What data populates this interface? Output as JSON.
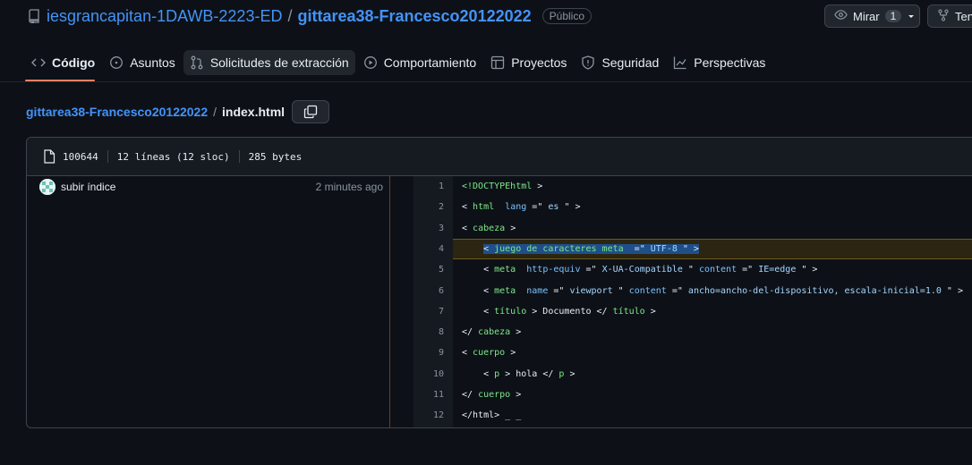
{
  "repo": {
    "owner": "iesgrancapitan-1DAWB-2223-ED",
    "separator": "/",
    "name": "gittarea38-Francesco20122022",
    "visibility": "Público"
  },
  "actions": {
    "watch_label": "Mirar",
    "watch_count": "1",
    "fork_label": "Tene"
  },
  "tabs": [
    {
      "label": "Código",
      "icon": "code-icon"
    },
    {
      "label": "Asuntos",
      "icon": "issue-icon"
    },
    {
      "label": "Solicitudes de extracción",
      "icon": "pull-request-icon"
    },
    {
      "label": "Comportamiento",
      "icon": "play-icon"
    },
    {
      "label": "Proyectos",
      "icon": "table-icon"
    },
    {
      "label": "Seguridad",
      "icon": "shield-icon"
    },
    {
      "label": "Perspectivas",
      "icon": "graph-icon"
    }
  ],
  "breadcrumb": {
    "repo": "gittarea38-Francesco20122022",
    "separator": "/",
    "file": "index.html"
  },
  "file_meta": {
    "mode": "100644",
    "lines": "12 líneas (12 sloc)",
    "size": "285 bytes"
  },
  "commit": {
    "message": "subir índice",
    "time": "2 minutes ago"
  },
  "colors": {
    "accent": "#4493f8",
    "tab_underline": "#f78166",
    "highlight_line": "#2c2511",
    "selection": "#1f4f8a"
  },
  "code_lines": [
    {
      "n": "1",
      "segments": [
        [
          "t-tag",
          "<!DOCTYPEhtml"
        ],
        [
          "t-def",
          " >"
        ]
      ]
    },
    {
      "n": "2",
      "segments": [
        [
          "t-def",
          "< "
        ],
        [
          "t-tag",
          "html"
        ],
        [
          "t-def",
          "  "
        ],
        [
          "t-attr",
          "lang"
        ],
        [
          "t-def",
          " =\""
        ],
        [
          "t-str",
          " es "
        ],
        [
          "t-def",
          "\" >"
        ]
      ]
    },
    {
      "n": "3",
      "segments": [
        [
          "t-def",
          "< "
        ],
        [
          "t-tag",
          "cabeza"
        ],
        [
          "t-def",
          " >"
        ]
      ]
    },
    {
      "n": "4",
      "segments": [
        [
          "t-def",
          "    "
        ],
        [
          "sel t-def",
          "< "
        ],
        [
          "sel t-tag",
          "juego de caracteres meta"
        ],
        [
          "sel t-def",
          "  =\""
        ],
        [
          "sel t-str",
          " UTF-8 "
        ],
        [
          "sel t-def",
          "\" >"
        ]
      ]
    },
    {
      "n": "5",
      "segments": [
        [
          "t-def",
          "    < "
        ],
        [
          "t-tag",
          "meta"
        ],
        [
          "t-def",
          "  "
        ],
        [
          "t-attr",
          "http-equiv"
        ],
        [
          "t-def",
          " =\""
        ],
        [
          "t-str",
          " X-UA-Compatible "
        ],
        [
          "t-def",
          "\" "
        ],
        [
          "t-attr",
          "content"
        ],
        [
          "t-def",
          " =\""
        ],
        [
          "t-str",
          " IE=edge "
        ],
        [
          "t-def",
          "\" >"
        ]
      ]
    },
    {
      "n": "6",
      "segments": [
        [
          "t-def",
          "    < "
        ],
        [
          "t-tag",
          "meta"
        ],
        [
          "t-def",
          "  "
        ],
        [
          "t-attr",
          "name"
        ],
        [
          "t-def",
          " =\""
        ],
        [
          "t-str",
          " viewport "
        ],
        [
          "t-def",
          "\" "
        ],
        [
          "t-attr",
          "content"
        ],
        [
          "t-def",
          " =\""
        ],
        [
          "t-str",
          " ancho=ancho-del-dispositivo, escala-inicial=1.0 "
        ],
        [
          "t-def",
          "\" >"
        ]
      ]
    },
    {
      "n": "7",
      "segments": [
        [
          "t-def",
          "    < "
        ],
        [
          "t-tag",
          "título"
        ],
        [
          "t-def",
          " > Documento </ "
        ],
        [
          "t-tag",
          "título"
        ],
        [
          "t-def",
          " >"
        ]
      ]
    },
    {
      "n": "8",
      "segments": [
        [
          "t-def",
          "</ "
        ],
        [
          "t-tag",
          "cabeza"
        ],
        [
          "t-def",
          " >"
        ]
      ]
    },
    {
      "n": "9",
      "segments": [
        [
          "t-def",
          "< "
        ],
        [
          "t-tag",
          "cuerpo"
        ],
        [
          "t-def",
          " >"
        ]
      ]
    },
    {
      "n": "10",
      "segments": [
        [
          "t-def",
          "    < "
        ],
        [
          "t-tag",
          "p"
        ],
        [
          "t-def",
          " > hola </ "
        ],
        [
          "t-tag",
          "p"
        ],
        [
          "t-def",
          " >"
        ]
      ]
    },
    {
      "n": "11",
      "segments": [
        [
          "t-def",
          "</ "
        ],
        [
          "t-tag",
          "cuerpo"
        ],
        [
          "t-def",
          " >"
        ]
      ]
    },
    {
      "n": "12",
      "segments": [
        [
          "t-def",
          "</html> _ _"
        ]
      ]
    }
  ]
}
